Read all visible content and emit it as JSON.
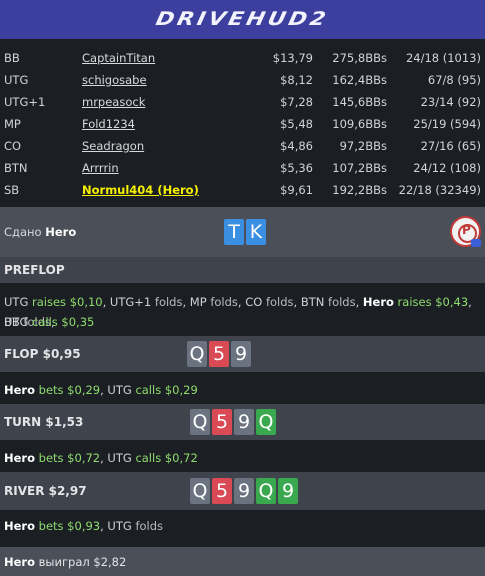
{
  "app": {
    "logo_text": "DRIVEHUD2"
  },
  "players": [
    {
      "pos": "BB",
      "name": "CaptainTitan",
      "stack": "$13,79",
      "bbs": "275,8BBs",
      "stat": "24/18 (1013)",
      "hero": false
    },
    {
      "pos": "UTG",
      "name": "schigosabe",
      "stack": "$8,12",
      "bbs": "162,4BBs",
      "stat": "67/8 (95)",
      "hero": false
    },
    {
      "pos": "UTG+1",
      "name": "mrpeasock",
      "stack": "$7,28",
      "bbs": "145,6BBs",
      "stat": "23/14 (92)",
      "hero": false
    },
    {
      "pos": "MP",
      "name": "Fold1234",
      "stack": "$5,48",
      "bbs": "109,6BBs",
      "stat": "25/19 (594)",
      "hero": false
    },
    {
      "pos": "CO",
      "name": "Seadragon",
      "stack": "$4,86",
      "bbs": "97,2BBs",
      "stat": "27/16 (65)",
      "hero": false
    },
    {
      "pos": "BTN",
      "name": "Arrrrin",
      "stack": "$5,36",
      "bbs": "107,2BBs",
      "stat": "24/12 (108)",
      "hero": false
    },
    {
      "pos": "SB",
      "name": "Normul404 (Hero)",
      "stack": "$9,61",
      "bbs": "192,2BBs",
      "stat": "22/18 (32349)",
      "hero": true
    }
  ],
  "dealt": {
    "label": "Сдано",
    "player": "Hero",
    "cards": [
      {
        "rank": "T",
        "suit": "diamond"
      },
      {
        "rank": "K",
        "suit": "diamond"
      }
    ]
  },
  "preflop": {
    "title": "PREFLOP",
    "line1": [
      {
        "t": "UTG ",
        "c": "plain"
      },
      {
        "t": "raises $0,10",
        "c": "verb"
      },
      {
        "t": ", UTG+1 ",
        "c": "plain"
      },
      {
        "t": "folds",
        "c": "fold"
      },
      {
        "t": ", MP ",
        "c": "plain"
      },
      {
        "t": "folds",
        "c": "fold"
      },
      {
        "t": ", CO ",
        "c": "plain"
      },
      {
        "t": "folds",
        "c": "fold"
      },
      {
        "t": ", BTN ",
        "c": "plain"
      },
      {
        "t": "folds",
        "c": "fold"
      },
      {
        "t": ", ",
        "c": "plain"
      },
      {
        "t": "Hero",
        "c": "hero"
      },
      {
        "t": " raises $0,43",
        "c": "verb"
      },
      {
        "t": ", BB ",
        "c": "plain"
      },
      {
        "t": "folds",
        "c": "fold"
      },
      {
        "t": ",",
        "c": "plain"
      }
    ],
    "line2": [
      {
        "t": "UTG ",
        "c": "plain"
      },
      {
        "t": "calls $0,35",
        "c": "verb"
      }
    ]
  },
  "streets": [
    {
      "title": "FLOP  $0,95",
      "cards": [
        {
          "rank": "Q",
          "suit": "spade"
        },
        {
          "rank": "5",
          "suit": "heart"
        },
        {
          "rank": "9",
          "suit": "spade"
        }
      ],
      "actions": [
        {
          "t": "Hero",
          "c": "hero"
        },
        {
          "t": " bets $0,29",
          "c": "verb"
        },
        {
          "t": ", UTG ",
          "c": "plain"
        },
        {
          "t": "calls $0,29",
          "c": "verb"
        }
      ]
    },
    {
      "title": "TURN  $1,53",
      "cards": [
        {
          "rank": "Q",
          "suit": "spade"
        },
        {
          "rank": "5",
          "suit": "heart"
        },
        {
          "rank": "9",
          "suit": "spade"
        },
        {
          "rank": "Q",
          "suit": "club"
        }
      ],
      "actions": [
        {
          "t": "Hero",
          "c": "hero"
        },
        {
          "t": " bets $0,72",
          "c": "verb"
        },
        {
          "t": ", UTG ",
          "c": "plain"
        },
        {
          "t": "calls $0,72",
          "c": "verb"
        }
      ]
    },
    {
      "title": "RIVER  $2,97",
      "cards": [
        {
          "rank": "Q",
          "suit": "spade"
        },
        {
          "rank": "5",
          "suit": "heart"
        },
        {
          "rank": "9",
          "suit": "spade"
        },
        {
          "rank": "Q",
          "suit": "club"
        },
        {
          "rank": "9",
          "suit": "club"
        }
      ],
      "actions": [
        {
          "t": "Hero",
          "c": "hero"
        },
        {
          "t": " bets $0,93",
          "c": "verb"
        },
        {
          "t": ", UTG ",
          "c": "plain"
        },
        {
          "t": "folds",
          "c": "fold"
        }
      ]
    }
  ],
  "result": {
    "player": "Hero",
    "text": "выиграл $2,82"
  },
  "colors": {
    "logo_bar": "#3d3f9f",
    "hero_name": "#f6f100",
    "verb": "#8edc6f",
    "heart": "#d94a55",
    "diamond": "#3b8fe3",
    "club": "#3aa84e",
    "spade": "#6b7380"
  }
}
